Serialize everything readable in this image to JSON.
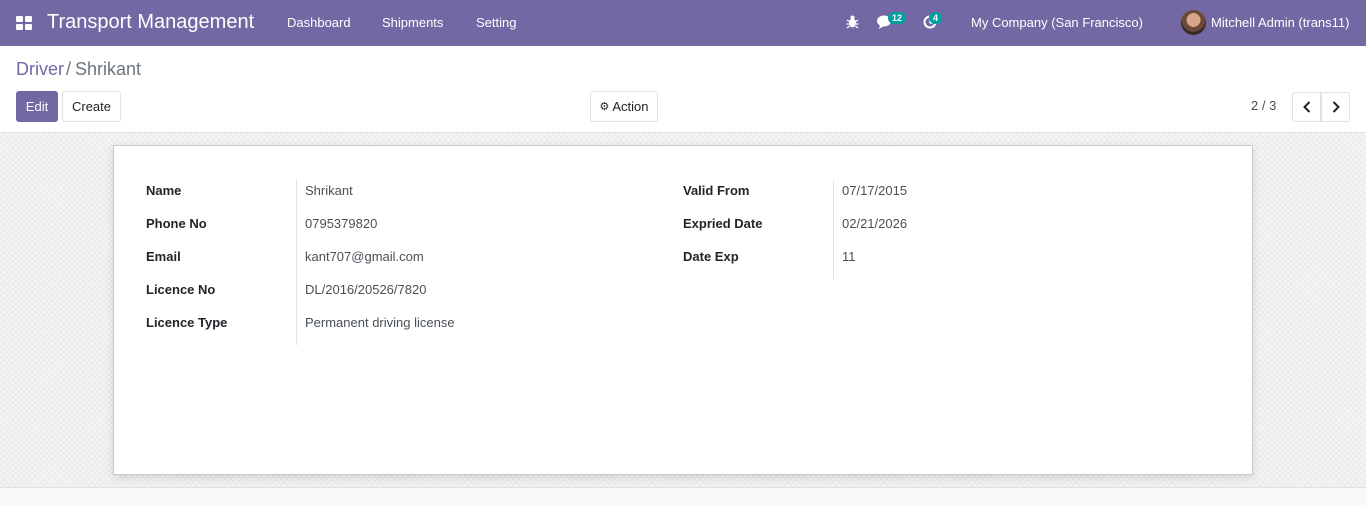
{
  "navbar": {
    "app_title": "Transport Management",
    "menu": [
      "Dashboard",
      "Shipments",
      "Setting"
    ],
    "messages_count": "12",
    "activities_count": "4",
    "company": "My Company (San Francisco)",
    "user": "Mitchell Admin (trans11)",
    "color": "#7367a4"
  },
  "breadcrumb": {
    "parent": "Driver",
    "separator": "/",
    "current": "Shrikant"
  },
  "buttons": {
    "edit": "Edit",
    "create": "Create",
    "action": "Action"
  },
  "pager": {
    "value": "2 / 3"
  },
  "form": {
    "left": [
      {
        "label": "Name",
        "value": "Shrikant"
      },
      {
        "label": "Phone No",
        "value": "0795379820"
      },
      {
        "label": "Email",
        "value": "kant707@gmail.com"
      },
      {
        "label": "Licence No",
        "value": "DL/2016/20526/7820"
      },
      {
        "label": "Licence Type",
        "value": "Permanent driving license"
      }
    ],
    "right": [
      {
        "label": "Valid From",
        "value": "07/17/2015"
      },
      {
        "label": "Expried Date",
        "value": "02/21/2026"
      },
      {
        "label": "Date Exp",
        "value": "11"
      }
    ]
  }
}
